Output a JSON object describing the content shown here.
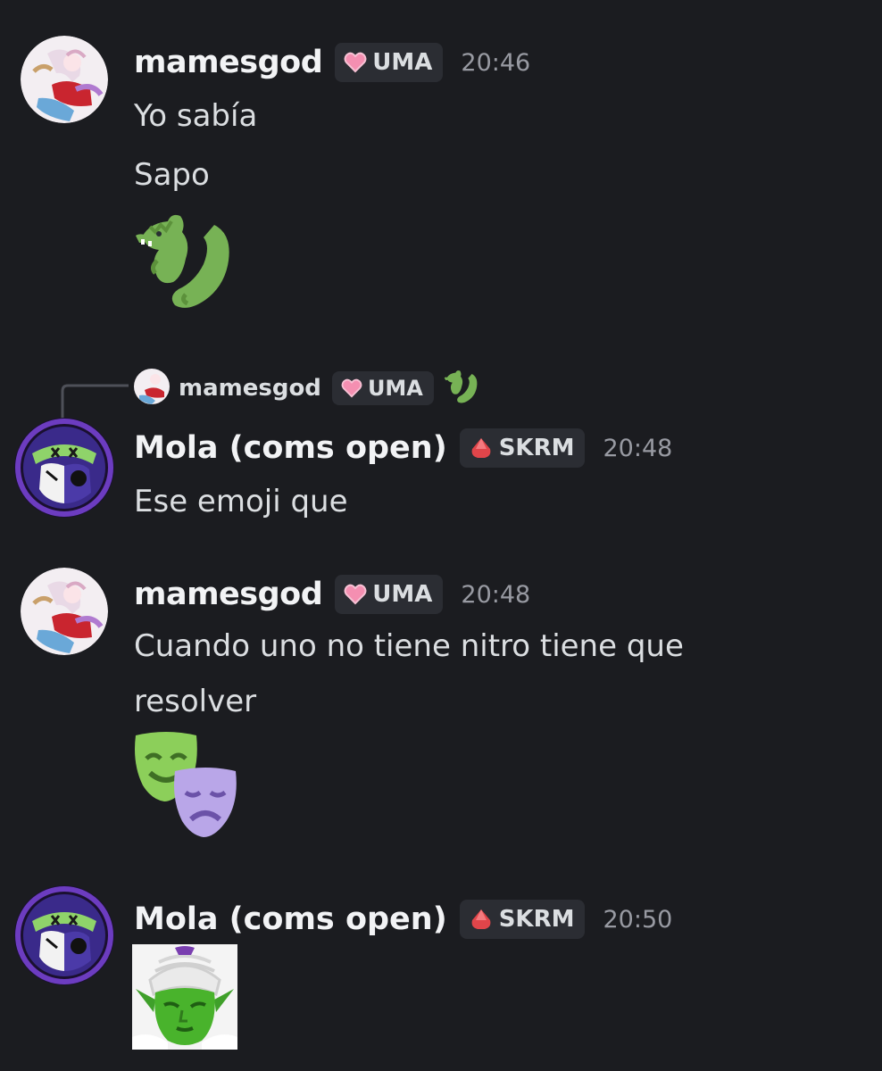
{
  "messages": [
    {
      "username": "mamesgod",
      "tag": "UMA",
      "time": "20:46",
      "lines": [
        "Yo sabía",
        "Sapo"
      ],
      "emoji": "dragon-emoji"
    },
    {
      "reply_to": {
        "username": "mamesgod",
        "tag": "UMA",
        "emoji": "dragon-emoji"
      },
      "username": "Mola (coms open)",
      "tag": "SKRM",
      "time": "20:48",
      "lines": [
        "Ese emoji que"
      ]
    },
    {
      "username": "mamesgod",
      "tag": "UMA",
      "time": "20:48",
      "lines": [
        "Cuando uno no tiene nitro tiene que",
        "resolver"
      ],
      "emoji": "performing-arts-emoji"
    },
    {
      "username": "Mola (coms open)",
      "tag": "SKRM",
      "time": "20:50",
      "image": "piccolo-sticker"
    }
  ],
  "colors": {
    "background": "#1b1c20",
    "username": "#f2f3f5",
    "text": "#dbdee1",
    "timestamp": "#989aa2",
    "tag_background": "#2b2d33",
    "uma_heart": "#f48fb1",
    "skrm_gem": "#e0454a"
  }
}
